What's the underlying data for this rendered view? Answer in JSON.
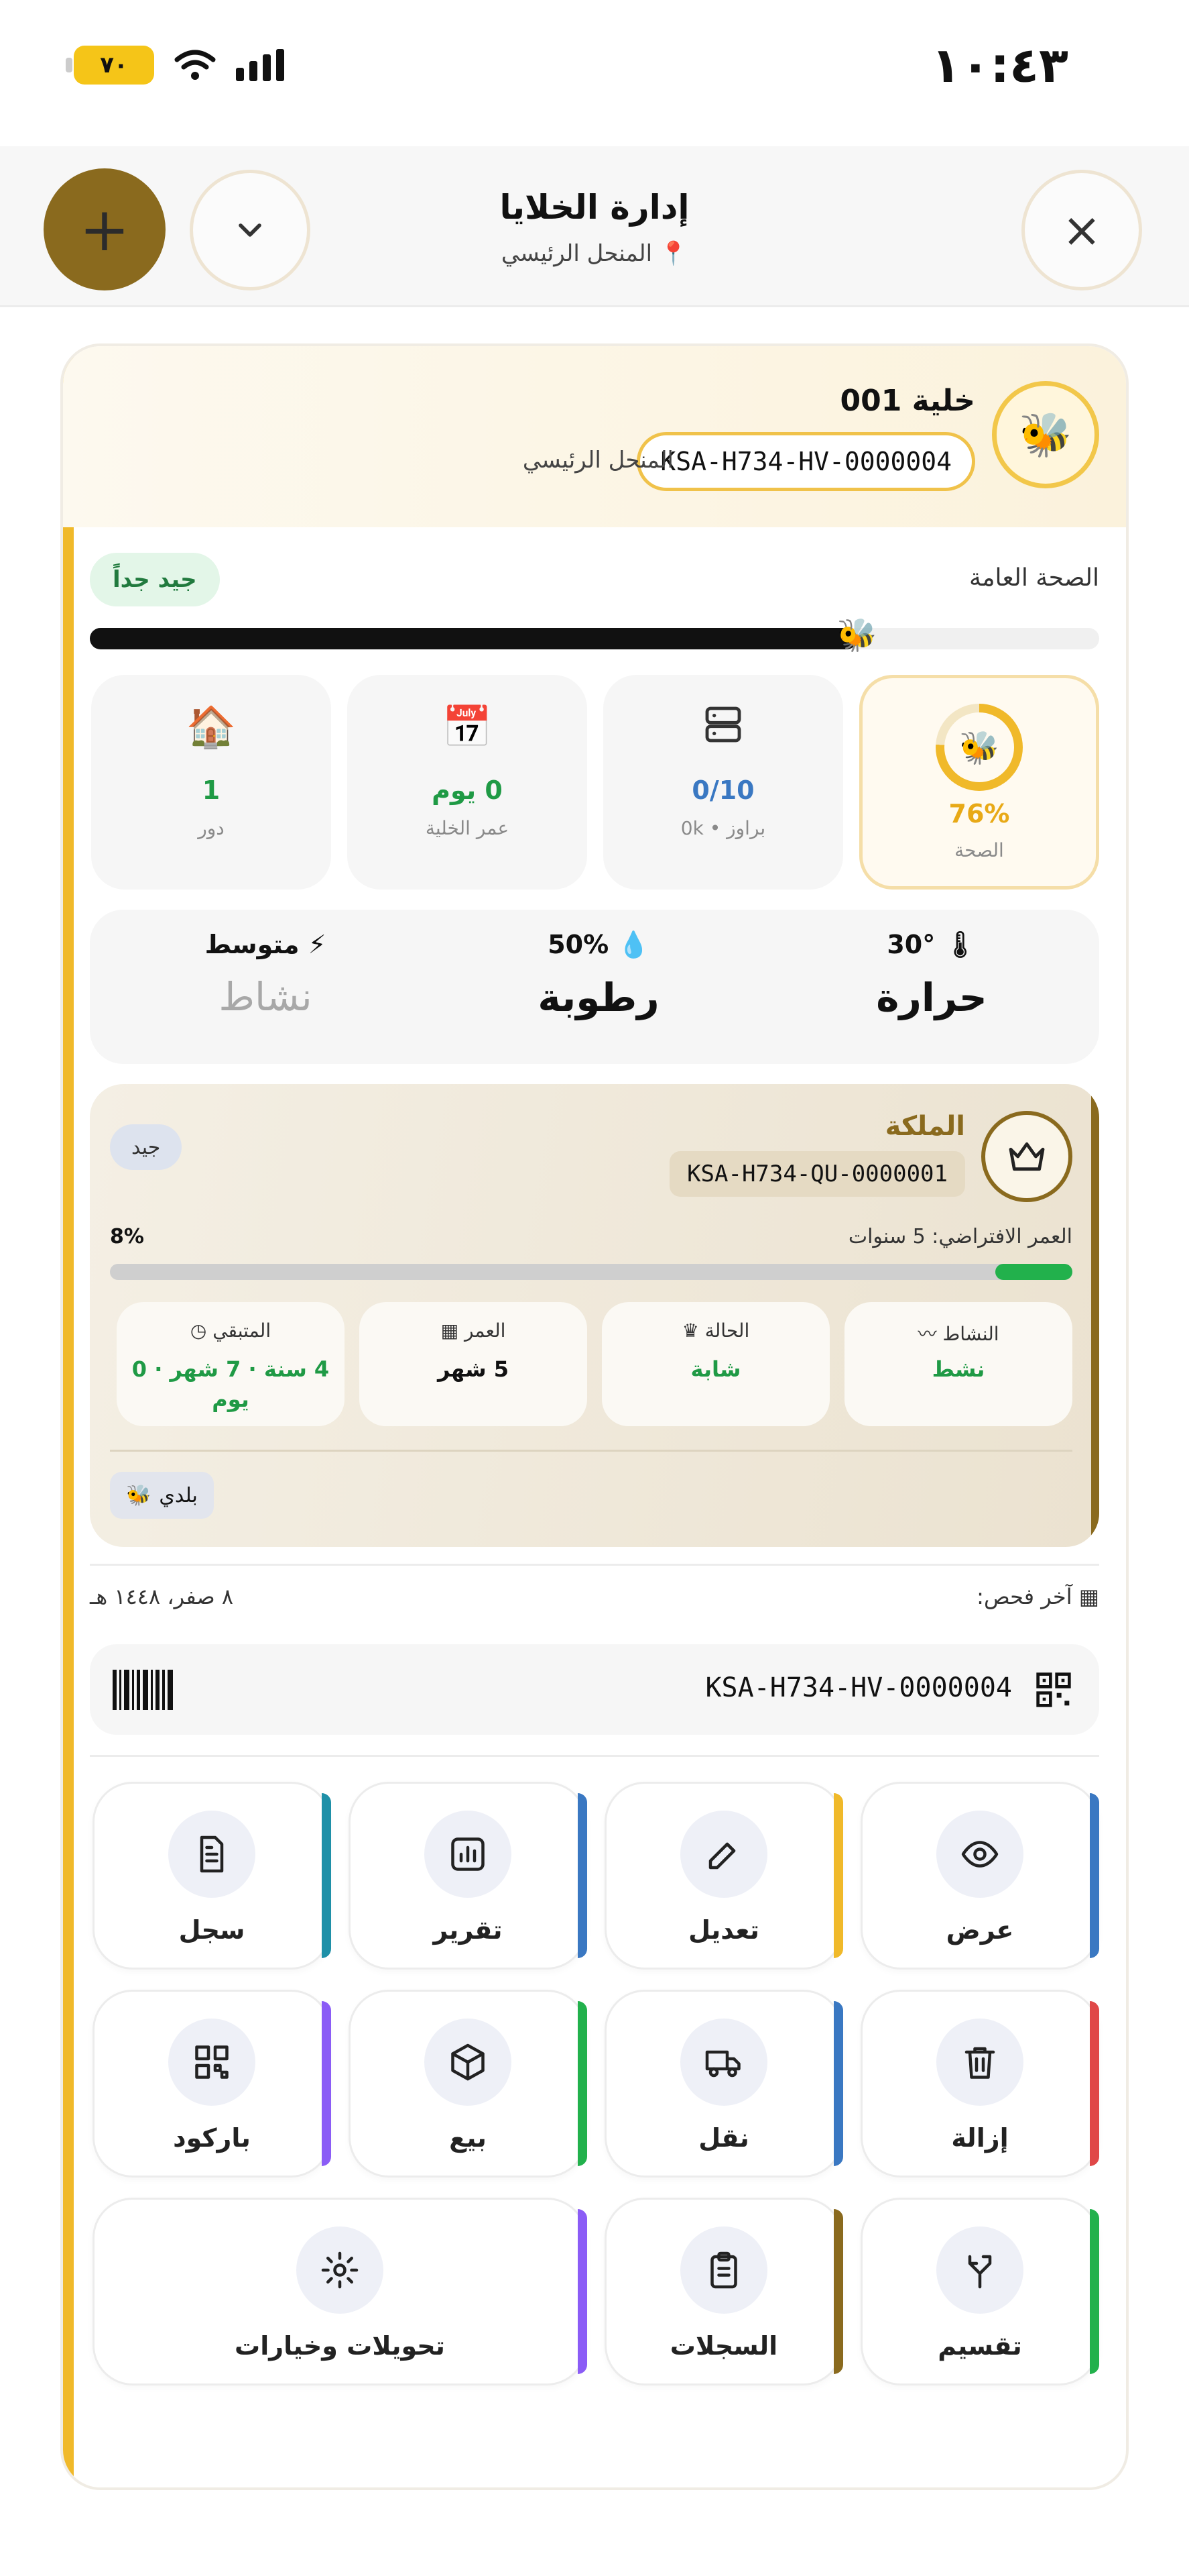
{
  "status_bar": {
    "time": "١٠:٤٣",
    "battery": "٧٠"
  },
  "header": {
    "title": "إدارة الخلايا",
    "subtitle": "المنحل الرئيسي",
    "close_label": "×",
    "add_label": "+"
  },
  "hive": {
    "name": "خلية 001",
    "code": "KSA-H734-HV-0000004",
    "apiary": "المنحل الرئيسي",
    "health_label": "الصحة العامة",
    "health_badge": "جيد جداً",
    "health_percent": 76
  },
  "stats": [
    {
      "value": "76%",
      "label": "الصحة",
      "color": "#e8a917"
    },
    {
      "value": "0/10",
      "label": "براوز • 0k",
      "color": "#3a78c2"
    },
    {
      "value": "0 يوم",
      "label": "عمر الخلية",
      "color": "#1f9a45"
    },
    {
      "value": "1",
      "label": "دور",
      "color": "#1f9a45"
    }
  ],
  "environment": {
    "temperature_value": "30°",
    "temperature_label": "حرارة",
    "humidity_value": "50%",
    "humidity_label": "رطوبة",
    "activity_value": "متوسط",
    "activity_label": "نشاط"
  },
  "queen": {
    "title": "الملكة",
    "code": "KSA-H734-QU-0000001",
    "status_badge": "جيد",
    "life_label": "العمر الافتراضي: 5 سنوات",
    "life_percent_text": "8%",
    "life_percent": 8,
    "tiles": [
      {
        "label": "النشاط",
        "value": "نشط",
        "icon": "activity-icon"
      },
      {
        "label": "الحالة",
        "value": "شابة",
        "icon": "crown-icon"
      },
      {
        "label": "العمر",
        "value": "5 شهر",
        "icon": "calendar-icon"
      },
      {
        "label": "المتبقي",
        "value": "4 سنة · 7 شهر · 0 يوم",
        "icon": "clock-icon"
      }
    ],
    "breed": "بلدي"
  },
  "inspection": {
    "label": "آخر فحص:",
    "date": "٨ صفر، ١٤٤٨ هـ"
  },
  "code_row": {
    "code": "KSA-H734-HV-0000004"
  },
  "actions": [
    {
      "label": "عرض",
      "icon": "eye-icon",
      "color": "#3a78c2"
    },
    {
      "label": "تعديل",
      "icon": "edit-icon",
      "color": "#f0b92a"
    },
    {
      "label": "تقرير",
      "icon": "chart-icon",
      "color": "#3a78c2"
    },
    {
      "label": "سجل",
      "icon": "document-icon",
      "color": "#1e90a8"
    },
    {
      "label": "إزالة",
      "icon": "trash-icon",
      "color": "#e04848"
    },
    {
      "label": "نقل",
      "icon": "truck-icon",
      "color": "#3a78c2"
    },
    {
      "label": "بيع",
      "icon": "box-icon",
      "color": "#22b14c"
    },
    {
      "label": "باركود",
      "icon": "qr-icon",
      "color": "#8b5cf6"
    },
    {
      "label": "تقسيم",
      "icon": "split-icon",
      "color": "#22b14c"
    },
    {
      "label": "السجلات",
      "icon": "clipboard-icon",
      "color": "#8a6a1e"
    },
    {
      "label": "تحويلات وخيارات",
      "icon": "gear-icon",
      "color": "#8b5cf6"
    }
  ]
}
